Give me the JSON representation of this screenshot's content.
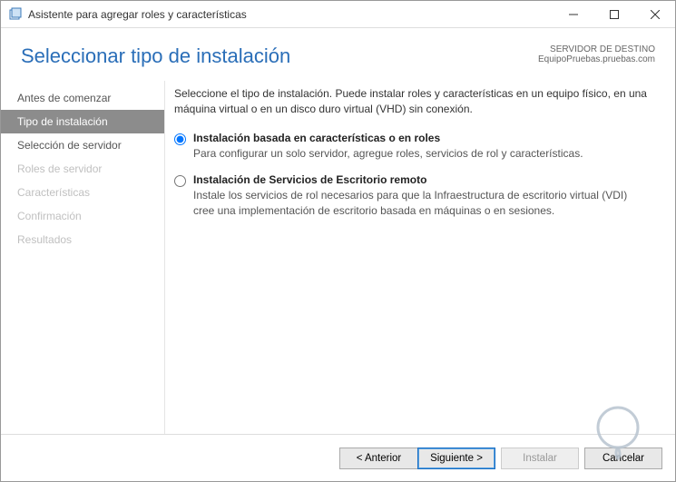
{
  "window": {
    "title": "Asistente para agregar roles y características"
  },
  "header": {
    "title": "Seleccionar tipo de instalación",
    "destination_label": "SERVIDOR DE DESTINO",
    "destination_value": "EquipoPruebas.pruebas.com"
  },
  "sidebar": {
    "items": [
      {
        "label": "Antes de comenzar",
        "state": "done"
      },
      {
        "label": "Tipo de instalación",
        "state": "active"
      },
      {
        "label": "Selección de servidor",
        "state": "done"
      },
      {
        "label": "Roles de servidor",
        "state": "disabled"
      },
      {
        "label": "Características",
        "state": "disabled"
      },
      {
        "label": "Confirmación",
        "state": "disabled"
      },
      {
        "label": "Resultados",
        "state": "disabled"
      }
    ]
  },
  "content": {
    "intro": "Seleccione el tipo de instalación. Puede instalar roles y características en un equipo físico, en una máquina virtual o en un disco duro virtual (VHD) sin conexión.",
    "options": [
      {
        "title": "Instalación basada en características o en roles",
        "desc": "Para configurar un solo servidor, agregue roles, servicios de rol y características.",
        "selected": true
      },
      {
        "title": "Instalación de Servicios de Escritorio remoto",
        "desc": "Instale los servicios de rol necesarios para que la Infraestructura de escritorio virtual (VDI) cree una implementación de escritorio basada en máquinas o en sesiones.",
        "selected": false
      }
    ]
  },
  "footer": {
    "prev": "< Anterior",
    "next": "Siguiente >",
    "install": "Instalar",
    "cancel": "Cancelar"
  }
}
